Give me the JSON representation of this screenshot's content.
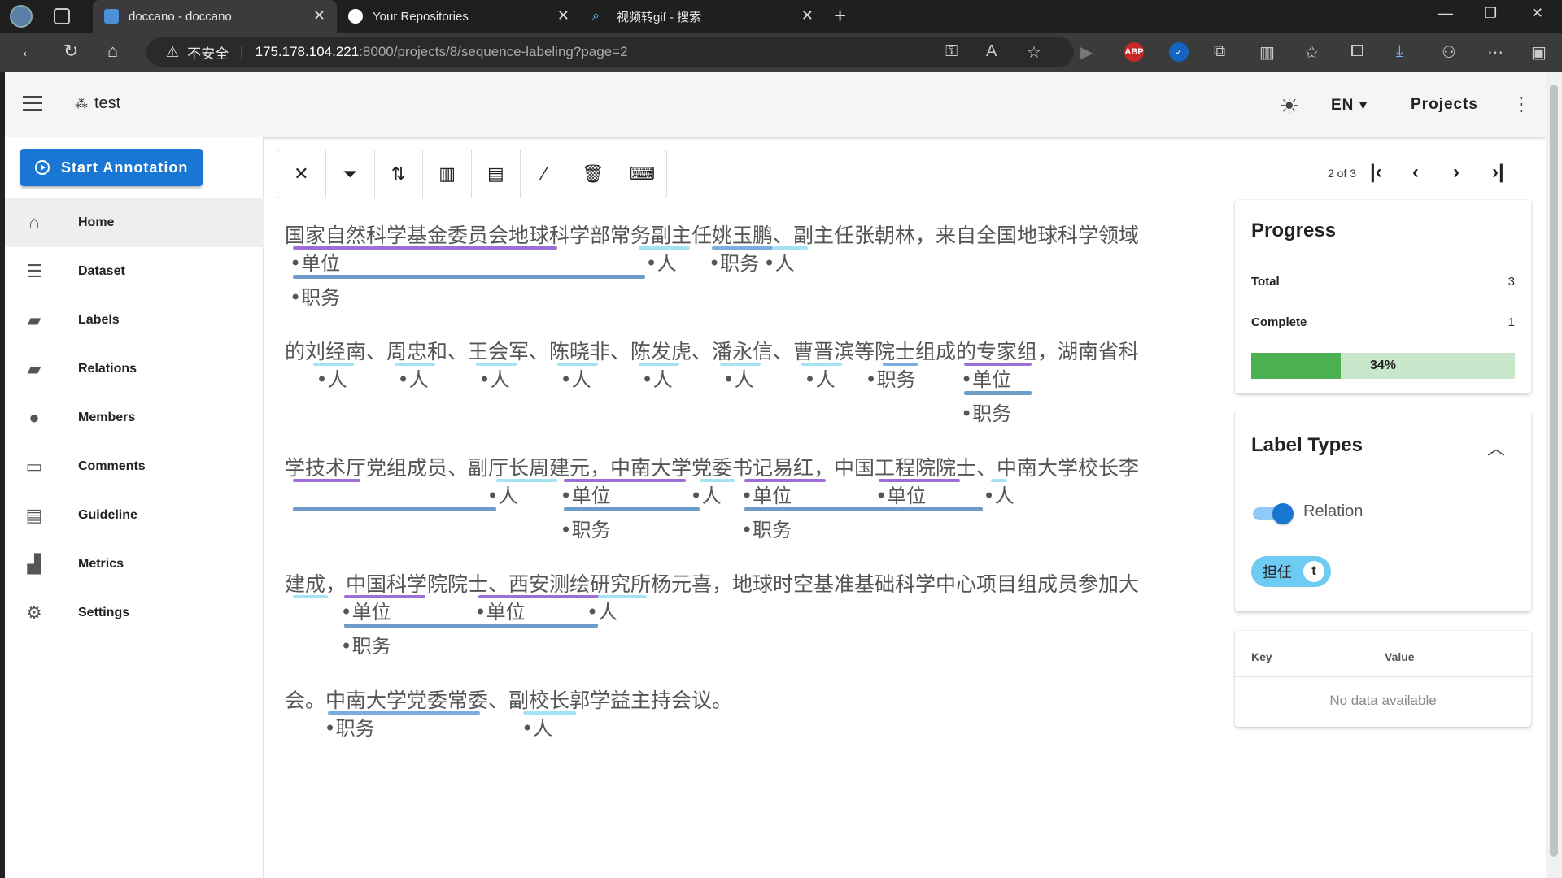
{
  "browser": {
    "tabs": [
      {
        "title": "doccano - doccano",
        "active": true
      },
      {
        "title": "Your Repositories",
        "active": false
      },
      {
        "title": "视频转gif - 搜索",
        "active": false
      }
    ],
    "address": {
      "warning": "不安全",
      "separator": "|",
      "host": "175.178.104.221",
      "path": ":8000/projects/8/sequence-labeling?page=2"
    },
    "extensions": [
      "ABP"
    ]
  },
  "appbar": {
    "project_name": "test",
    "language": "EN",
    "projects_label": "Projects"
  },
  "sidebar": {
    "start_button": "Start Annotation",
    "items": [
      {
        "label": "Home",
        "icon": "home-icon"
      },
      {
        "label": "Dataset",
        "icon": "database-icon"
      },
      {
        "label": "Labels",
        "icon": "label-icon"
      },
      {
        "label": "Relations",
        "icon": "label-icon"
      },
      {
        "label": "Members",
        "icon": "person-icon"
      },
      {
        "label": "Comments",
        "icon": "comment-icon"
      },
      {
        "label": "Guideline",
        "icon": "book-icon"
      },
      {
        "label": "Metrics",
        "icon": "chart-icon"
      },
      {
        "label": "Settings",
        "icon": "gear-icon"
      }
    ]
  },
  "pager": {
    "text": "2 of 3"
  },
  "document": {
    "lines": [
      "国家自然科学基金委员会地球科学部常务副主任姚玉鹏、副主任张朝林，来自全国地球科学领域",
      "的刘经南、周忠和、王会军、陈晓非、陈发虎、潘永信、曹晋滨等院士组成的专家组，湖南省科",
      "学技术厅党组成员、副厅长周建元，中南大学党委书记易红，中国工程院院士、中南大学校长李",
      "建成，中国科学院院士、西安测绘研究所杨元喜，地球时空基准基础科学中心项目组成员参加大",
      "会。中南大学党委常委、副校长郭学益主持会议。"
    ],
    "labels": {
      "org": "单位",
      "position": "职务",
      "person": "人"
    }
  },
  "progress": {
    "title": "Progress",
    "total_label": "Total",
    "total_value": "3",
    "complete_label": "Complete",
    "complete_value": "1",
    "percent_text": "34%",
    "percent_value": 34
  },
  "label_types": {
    "title": "Label Types",
    "relation_label": "Relation",
    "relation_enabled": true,
    "chips": [
      {
        "label": "担任",
        "key": "t"
      }
    ]
  },
  "metadata_table": {
    "headers": [
      "Key",
      "Value"
    ],
    "empty_text": "No data available"
  },
  "colors": {
    "primary": "#1976d2",
    "org_underline": "#9c6fd6",
    "person_underline": "#a6e3f2",
    "position_underline": "#7aaee0",
    "relation_line": "#6d9cc6",
    "progress_fill": "#4caf50",
    "progress_track": "#c8e6c9",
    "chip": "#6ecbf2"
  }
}
